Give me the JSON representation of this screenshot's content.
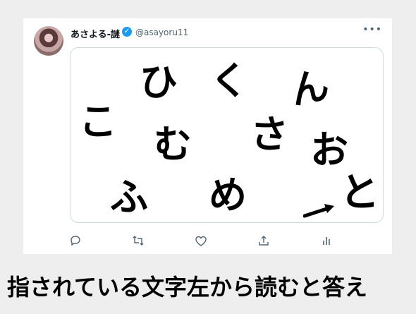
{
  "tweet": {
    "display_name": "あさよる-謎",
    "handle": "@asayoru11",
    "verified_icon": "verified-badge-icon",
    "more_icon": "more-options-icon",
    "more_glyph": "•••"
  },
  "puzzle": {
    "glyphs": [
      "ひ",
      "く",
      "ん",
      "こ",
      "む",
      "さ",
      "お",
      "ふ",
      "め",
      "と"
    ],
    "arrow_icon": "arrow-right-icon"
  },
  "actions": [
    {
      "name": "reply-icon"
    },
    {
      "name": "retweet-icon"
    },
    {
      "name": "like-icon"
    },
    {
      "name": "share-icon"
    },
    {
      "name": "analytics-icon"
    }
  ],
  "caption": "指されている文字左から読むと答え",
  "colors": {
    "verified": "#1d9bf0",
    "icon_gray": "#536471",
    "border": "#cfd9de"
  }
}
